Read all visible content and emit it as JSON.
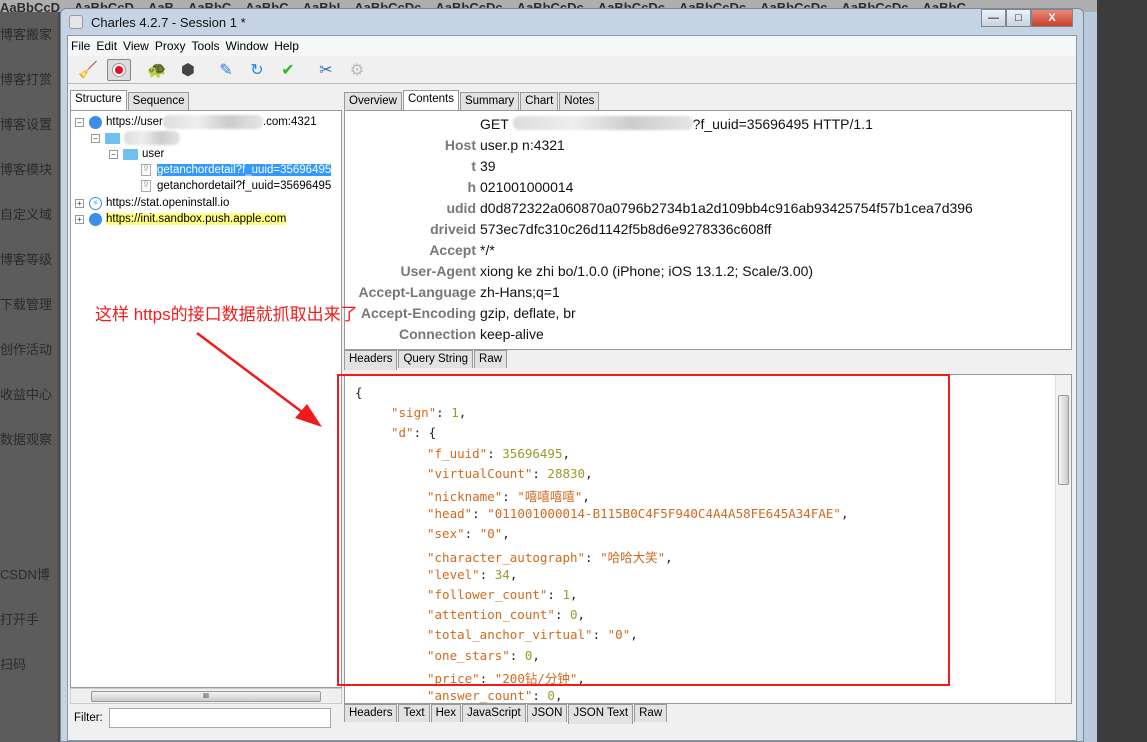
{
  "background": {
    "ribbon": [
      "AaBbCcD",
      "AaBbCcD",
      "AaB",
      "AaBbC",
      "AaBbC",
      "AaBbI",
      "AaBbCcDc",
      "AaBbCcDc",
      "AaBbCcDc",
      "AaBbCcDc",
      "AaBbCcDc",
      "AaBbCcDc",
      "AaBbCcDc",
      "AaBbC"
    ],
    "menu": [
      "博客搬家",
      "博客打赏",
      "博客设置",
      "博客模块",
      "自定义域",
      "博客等级",
      "下载管理",
      "创作活动",
      "收益中心",
      "数据观察",
      "",
      "",
      "CSDN博",
      "打开手",
      "扫码"
    ]
  },
  "window": {
    "title": "Charles 4.2.7 - Session 1 *",
    "minimize": "—",
    "maximize": "□",
    "close": "X"
  },
  "menubar": [
    "File",
    "Edit",
    "View",
    "Proxy",
    "Tools",
    "Window",
    "Help"
  ],
  "toolbar": [
    {
      "name": "broom-icon",
      "glyph": "🧹"
    },
    {
      "name": "record-icon",
      "glyph": ""
    },
    {
      "name": "throttle-turtle-icon",
      "glyph": "🐢"
    },
    {
      "name": "breakpoint-hexagon-icon",
      "glyph": "⬢"
    },
    {
      "name": "compose-pen-icon",
      "glyph": "✎"
    },
    {
      "name": "repeat-icon",
      "glyph": "↻"
    },
    {
      "name": "validate-check-icon",
      "glyph": "✔"
    },
    {
      "name": "tools-icon",
      "glyph": "✂"
    },
    {
      "name": "settings-gear-icon",
      "glyph": "⚙"
    }
  ],
  "left": {
    "tabs": [
      "Structure",
      "Sequence"
    ],
    "selected_tab": "Structure",
    "tree": {
      "host1_prefix": "https://user",
      "host1_suffix": ".com:4321",
      "folder_user": "user",
      "req1": "getanchordetail?f_uuid=35696495",
      "req2": "getanchordetail?f_uuid=35696495",
      "host2": "https://stat.openinstall.io",
      "host3": "https://init.sandbox.push.apple.com"
    },
    "filter_label": "Filter:",
    "filter_value": ""
  },
  "right": {
    "tabs": [
      "Overview",
      "Contents",
      "Summary",
      "Chart",
      "Notes"
    ],
    "selected_tab": "Contents",
    "request_line": {
      "method": "GET",
      "suffix": "?f_uuid=35696495 HTTP/1.1"
    },
    "headers": [
      {
        "k": "Host",
        "v": "user.p                      n:4321"
      },
      {
        "k": "t",
        "v": "39"
      },
      {
        "k": "h",
        "v": "021001000014"
      },
      {
        "k": "udid",
        "v": "d0d872322a060870a0796b2734b1a2d109bb4c916ab93425754f57b1cea7d396"
      },
      {
        "k": "driveid",
        "v": "573ec7dfc310c26d1142f5b8d6e9278336c608ff"
      },
      {
        "k": "Accept",
        "v": "*/*"
      },
      {
        "k": "User-Agent",
        "v": "xiong ke zhi bo/1.0.0 (iPhone; iOS 13.1.2; Scale/3.00)"
      },
      {
        "k": "Accept-Language",
        "v": "zh-Hans;q=1"
      },
      {
        "k": "Accept-Encoding",
        "v": "gzip, deflate, br"
      },
      {
        "k": "Connection",
        "v": "keep-alive"
      }
    ],
    "request_tabs": [
      "Headers",
      "Query String",
      "Raw"
    ],
    "json_lines": [
      {
        "i": 0,
        "k": "",
        "v": "{",
        "t": "p"
      },
      {
        "i": 1,
        "k": "\"sign\"",
        "v": "1",
        "t": "n",
        "c": ","
      },
      {
        "i": 1,
        "k": "\"d\"",
        "v": "{",
        "t": "p"
      },
      {
        "i": 2,
        "k": "\"f_uuid\"",
        "v": "35696495",
        "t": "n",
        "c": ","
      },
      {
        "i": 2,
        "k": "\"virtualCount\"",
        "v": "28830",
        "t": "n",
        "c": ","
      },
      {
        "i": 2,
        "k": "\"nickname\"",
        "v": "\"嘻嘻嘻嘻\"",
        "t": "s",
        "c": ","
      },
      {
        "i": 2,
        "k": "\"head\"",
        "v": "\"011001000014-B115B0C4F5F940C4A4A58FE645A34FAE\"",
        "t": "s",
        "c": ","
      },
      {
        "i": 2,
        "k": "\"sex\"",
        "v": "\"0\"",
        "t": "s",
        "c": ","
      },
      {
        "i": 2,
        "k": "\"character_autograph\"",
        "v": "\"哈哈大笑\"",
        "t": "s",
        "c": ","
      },
      {
        "i": 2,
        "k": "\"level\"",
        "v": "34",
        "t": "n",
        "c": ","
      },
      {
        "i": 2,
        "k": "\"follower_count\"",
        "v": "1",
        "t": "n",
        "c": ","
      },
      {
        "i": 2,
        "k": "\"attention_count\"",
        "v": "0",
        "t": "n",
        "c": ","
      },
      {
        "i": 2,
        "k": "\"total_anchor_virtual\"",
        "v": "\"0\"",
        "t": "s",
        "c": ","
      },
      {
        "i": 2,
        "k": "\"one_stars\"",
        "v": "0",
        "t": "n",
        "c": ","
      },
      {
        "i": 2,
        "k": "\"price\"",
        "v": "\"200钻/分钟\"",
        "t": "s",
        "c": ","
      },
      {
        "i": 2,
        "k": "\"answer_count\"",
        "v": "0",
        "t": "n",
        "c": ","
      }
    ],
    "response_tabs": [
      "Headers",
      "Text",
      "Hex",
      "JavaScript",
      "JSON",
      "JSON Text",
      "Raw"
    ],
    "selected_response_tab": "JSON Text"
  },
  "annotation": {
    "text": "这样 https的接口数据就抓取出来了",
    "color": "#f21b1b"
  }
}
